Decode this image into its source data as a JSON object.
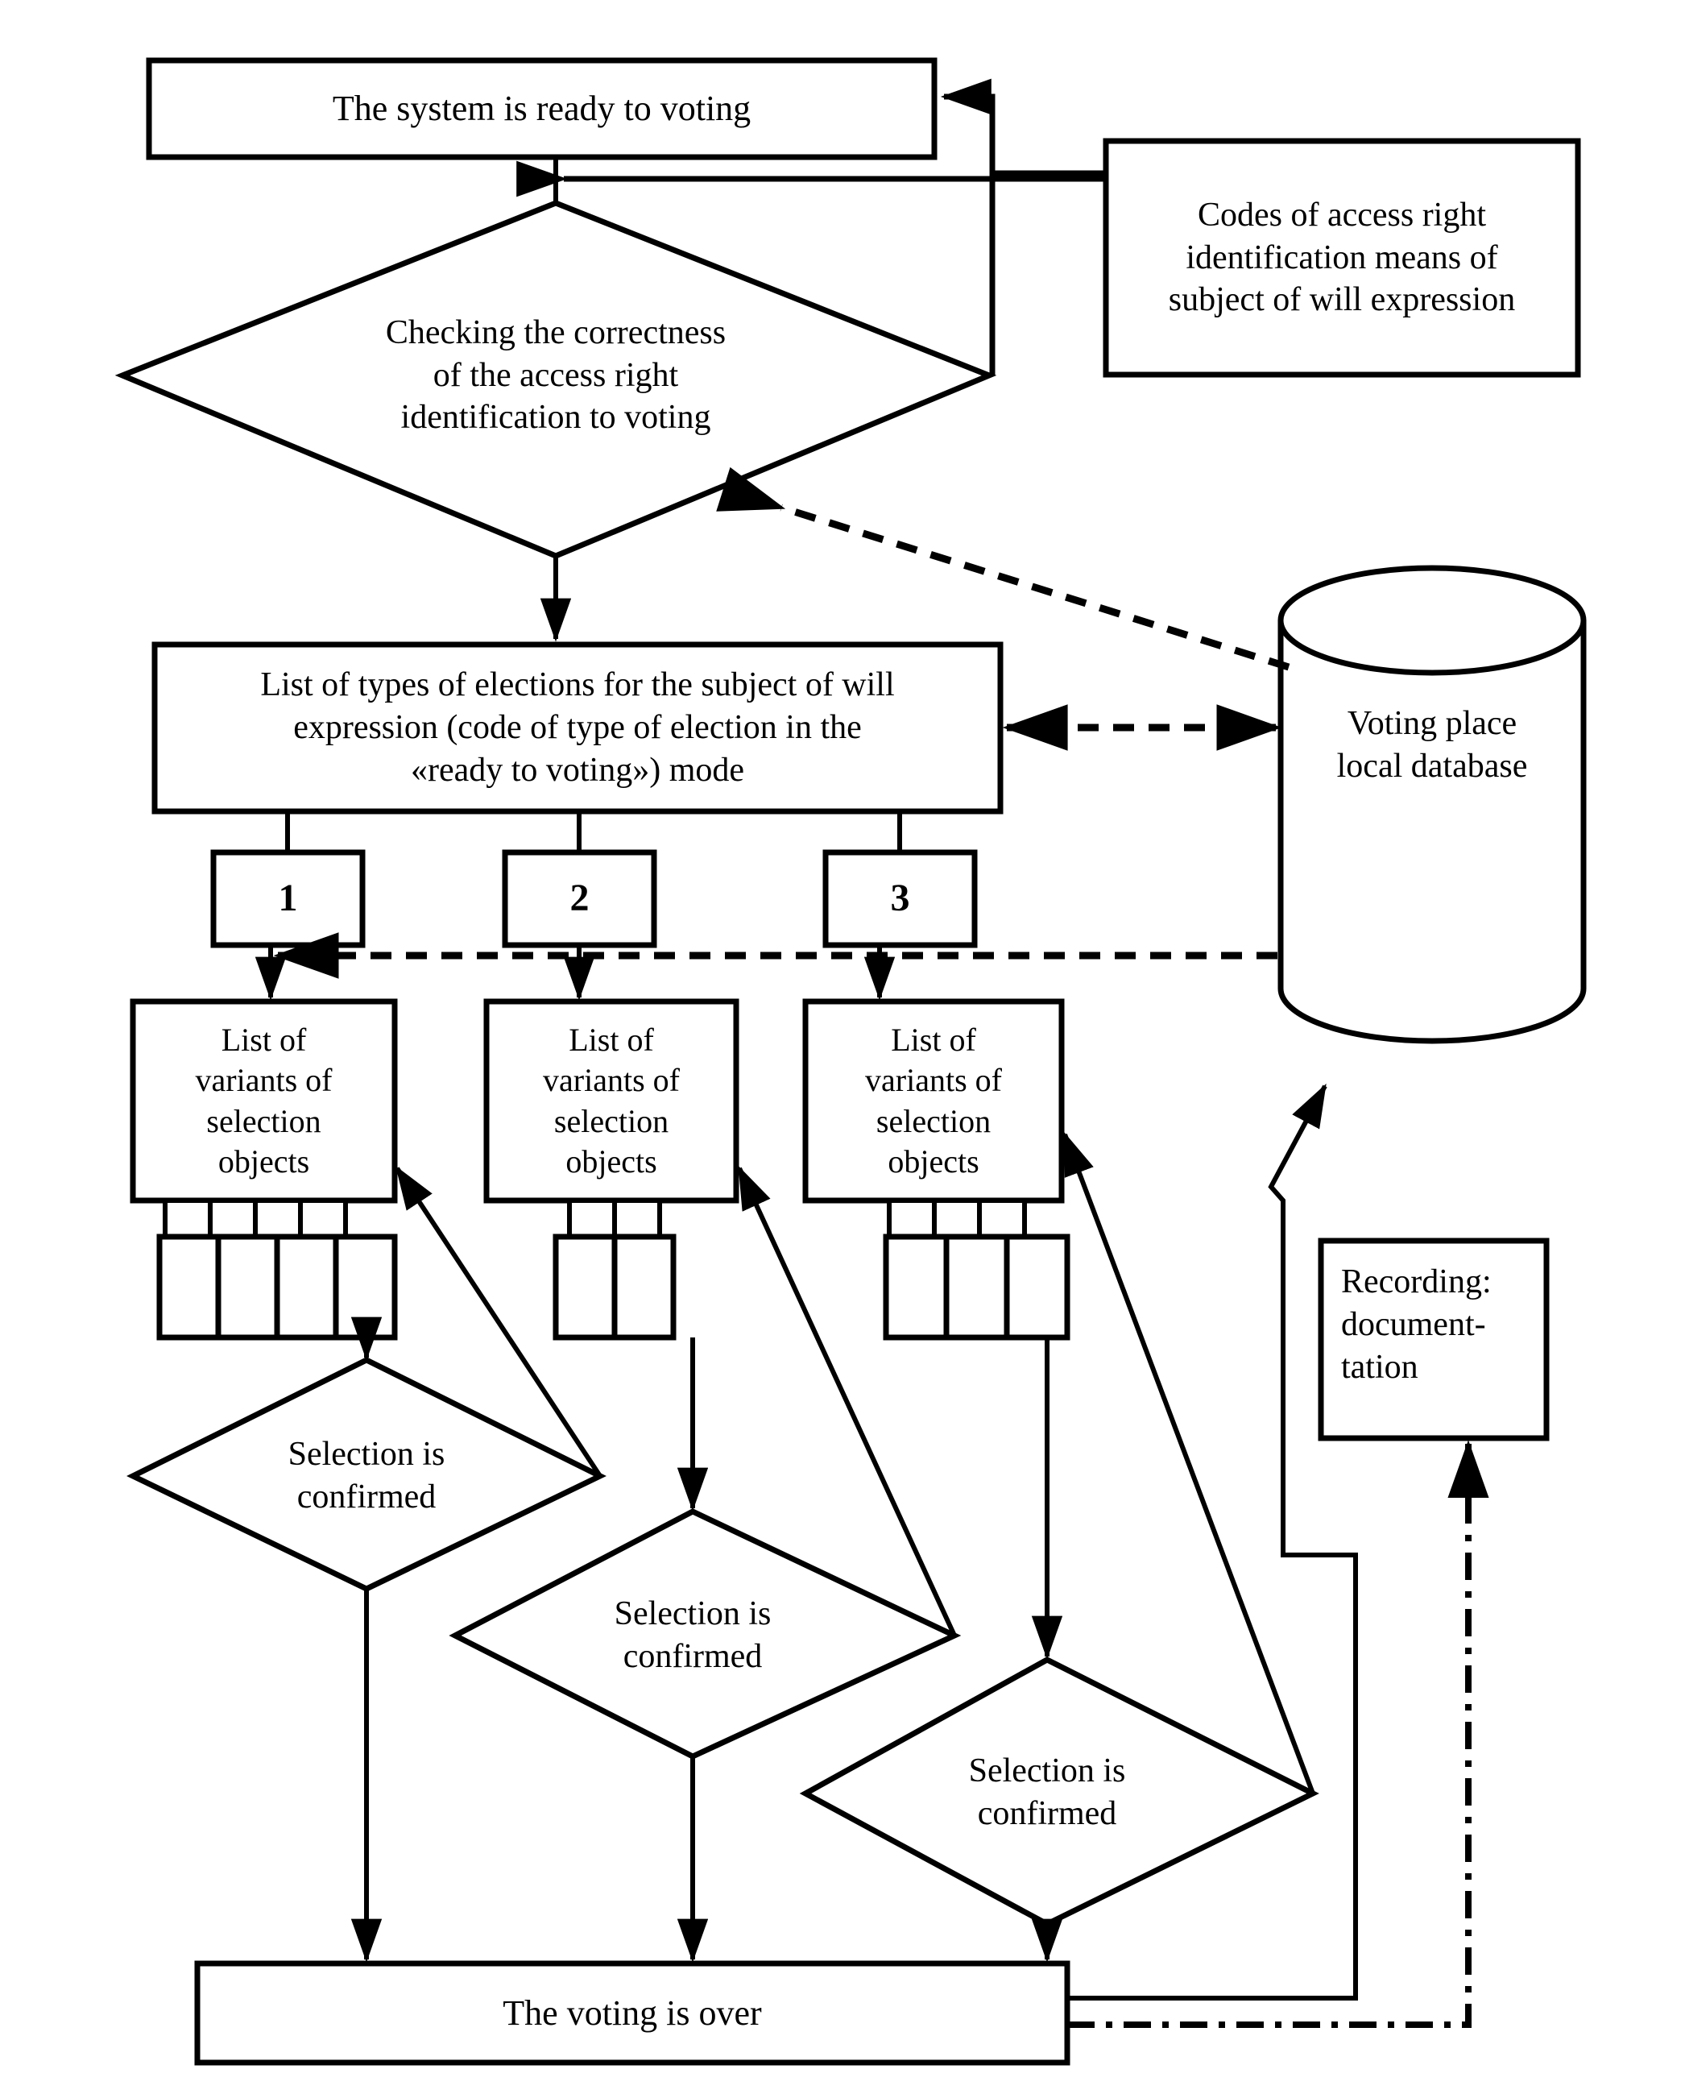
{
  "diagram": {
    "title": "Voting system flowchart",
    "colors": {
      "stroke": "#000000",
      "fill": "#ffffff",
      "text": "#000000"
    },
    "nodes": {
      "system_ready": {
        "label": "The system is ready to voting",
        "shape": "rectangle"
      },
      "access_codes": {
        "label": "Codes of access right\nidentification means of\nsubject of will expression",
        "shape": "rectangle"
      },
      "check_access": {
        "label": "Checking the correctness\nof the access right\nidentification to voting",
        "shape": "diamond"
      },
      "election_types": {
        "label": "List of types of elections for the subject of will\nexpression (code of type of election in the\n«ready to voting») mode",
        "shape": "rectangle"
      },
      "database": {
        "label": "Voting place\nlocal database",
        "shape": "cylinder"
      },
      "recording": {
        "label": "Recording:\ndocument-\ntation",
        "shape": "rectangle"
      },
      "voting_over": {
        "label": "The voting is over",
        "shape": "rectangle"
      }
    },
    "election_buttons": [
      {
        "label": "1"
      },
      {
        "label": "2"
      },
      {
        "label": "3"
      }
    ],
    "variant_lists": [
      {
        "label": "List of\nvariants of\nselection\nobjects",
        "cells": 4
      },
      {
        "label": "List of\nvariants of\nselection\nobjects",
        "cells": 2
      },
      {
        "label": "List of\nvariants of\nselection\nobjects",
        "cells": 3
      }
    ],
    "selection_diamonds": [
      {
        "label": "Selection is\nconfirmed"
      },
      {
        "label": "Selection is\nconfirmed"
      },
      {
        "label": "Selection is\nconfirmed"
      }
    ]
  }
}
